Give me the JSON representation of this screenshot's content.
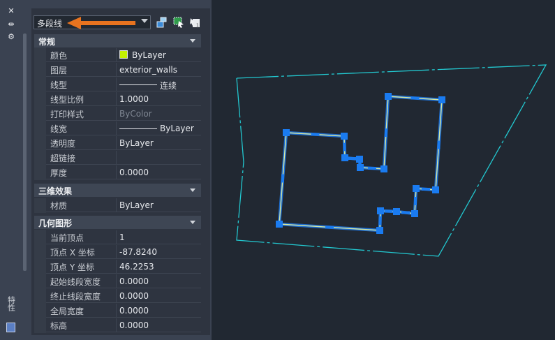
{
  "sidebar": {
    "close_icon": "close-icon",
    "pin_icon": "pin-icon",
    "settings_icon": "settings-icon",
    "vertical_title": "特性"
  },
  "selector": {
    "value": "多段线"
  },
  "toolbar_icons": [
    "quick-select-icon",
    "select-objects-icon",
    "toggle-pickadd-icon"
  ],
  "categories": {
    "general": {
      "label": "常规",
      "rows": [
        {
          "name": "颜色",
          "value": "ByLayer",
          "kind": "swatch"
        },
        {
          "name": "图层",
          "value": "exterior_walls"
        },
        {
          "name": "线型",
          "value": "连续",
          "kind": "line"
        },
        {
          "name": "线型比例",
          "value": "1.0000"
        },
        {
          "name": "打印样式",
          "value": "ByColor",
          "dim": true
        },
        {
          "name": "线宽",
          "value": "ByLayer",
          "kind": "line"
        },
        {
          "name": "透明度",
          "value": "ByLayer"
        },
        {
          "name": "超链接",
          "value": ""
        },
        {
          "name": "厚度",
          "value": "0.0000"
        }
      ]
    },
    "three_d": {
      "label": "三维效果",
      "rows": [
        {
          "name": "材质",
          "value": "ByLayer"
        }
      ]
    },
    "geometry": {
      "label": "几何图形",
      "rows": [
        {
          "name": "当前顶点",
          "value": "1"
        },
        {
          "name": "顶点 X 坐标",
          "value": "-87.8240"
        },
        {
          "name": "顶点 Y 坐标",
          "value": "46.2253"
        },
        {
          "name": "起始线段宽度",
          "value": "0.0000"
        },
        {
          "name": "终止线段宽度",
          "value": "0.0000"
        },
        {
          "name": "全局宽度",
          "value": "0.0000"
        },
        {
          "name": "标高",
          "value": "0.0000"
        }
      ]
    }
  },
  "colors": {
    "bylayer_swatch": "#c4f000",
    "polyline": "#d8e8a0",
    "grip": "#1a7bf0",
    "boundary": "#22c8d0",
    "annotation_arrow": "#e8731f"
  }
}
